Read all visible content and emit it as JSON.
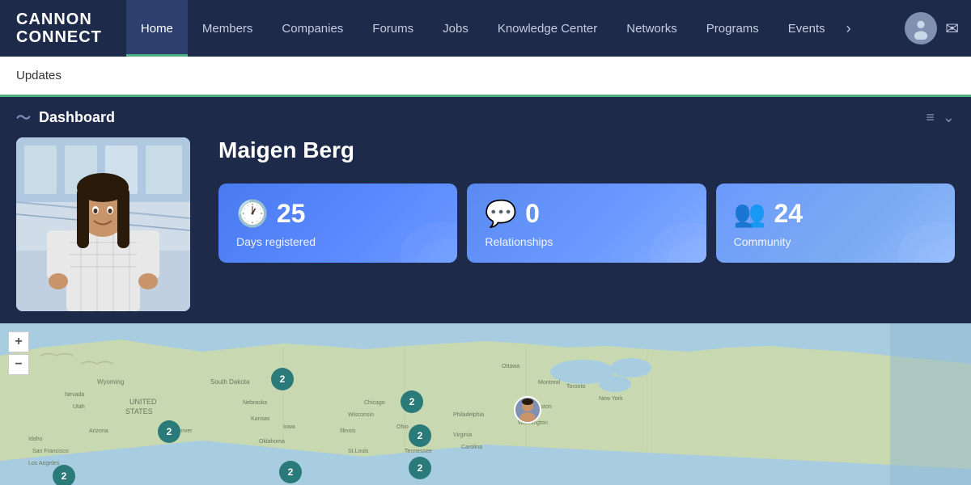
{
  "brand": {
    "line1": "CANNON",
    "line2": "CONNECT"
  },
  "nav": {
    "items": [
      {
        "id": "home",
        "label": "Home",
        "active": true
      },
      {
        "id": "members",
        "label": "Members",
        "active": false
      },
      {
        "id": "companies",
        "label": "Companies",
        "active": false
      },
      {
        "id": "forums",
        "label": "Forums",
        "active": false
      },
      {
        "id": "jobs",
        "label": "Jobs",
        "active": false
      },
      {
        "id": "knowledge-center",
        "label": "Knowledge Center",
        "active": false
      },
      {
        "id": "networks",
        "label": "Networks",
        "active": false
      },
      {
        "id": "programs",
        "label": "Programs",
        "active": false
      },
      {
        "id": "events",
        "label": "Events",
        "active": false
      }
    ],
    "more_icon": "›",
    "mail_icon": "✉"
  },
  "updates_bar": {
    "label": "Updates"
  },
  "dashboard": {
    "title": "Dashboard",
    "controls": {
      "menu_icon": "≡",
      "dropdown_icon": "⌄"
    }
  },
  "user": {
    "name": "Maigen Berg"
  },
  "stats": [
    {
      "id": "days-registered",
      "icon": "🕐",
      "number": "25",
      "label": "Days registered"
    },
    {
      "id": "relationships",
      "icon": "💬",
      "number": "0",
      "label": "Relationships"
    },
    {
      "id": "community",
      "icon": "👥",
      "number": "24",
      "label": "Community"
    }
  ],
  "map": {
    "zoom_in": "+",
    "zoom_out": "−",
    "markers": [
      {
        "id": "m1",
        "count": "2",
        "style": "left:195px;top:55px;"
      },
      {
        "id": "m2",
        "count": "2",
        "style": "left:335px;top:60px;"
      },
      {
        "id": "m3",
        "count": "2",
        "style": "left:497px;top:90px;"
      },
      {
        "id": "m4",
        "count": "2",
        "style": "left:70px;top:120px;"
      },
      {
        "id": "m5",
        "count": "2",
        "style": "left:497px;top:130px;"
      },
      {
        "id": "m6",
        "count": "2",
        "style": "left:497px;top:170px;"
      },
      {
        "id": "m7",
        "count": "2",
        "style": "left:345px;top:170px;"
      }
    ],
    "avatar_marker": {
      "style": "left:635px;top:95px;"
    }
  }
}
